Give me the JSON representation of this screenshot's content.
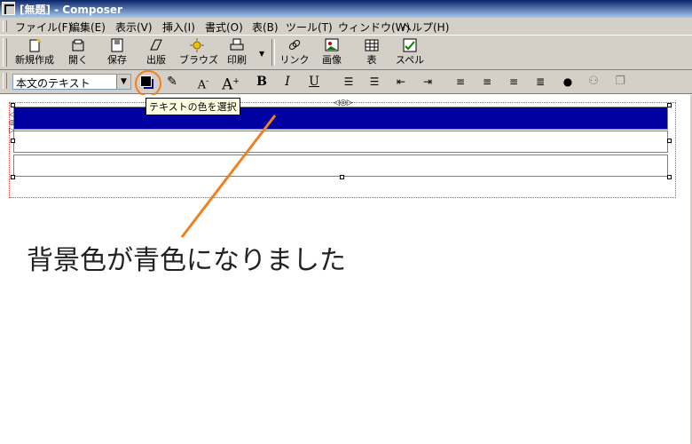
{
  "window": {
    "title": "[無題] - Composer"
  },
  "menu": [
    "ファイル(F)",
    "編集(E)",
    "表示(V)",
    "挿入(I)",
    "書式(O)",
    "表(B)",
    "ツール(T)",
    "ウィンドウ(W)",
    "ヘルプ(H)"
  ],
  "toolbar": {
    "new_label": "新規作成",
    "open_label": "開く",
    "save_label": "保存",
    "publish_label": "出版",
    "browse_label": "ブラウズ",
    "print_label": "印刷",
    "link_label": "リンク",
    "image_label": "画像",
    "table_label": "表",
    "spell_label": "スペル"
  },
  "format": {
    "paragraph_style": "本文のテキスト",
    "bold": "B",
    "italic": "I",
    "underline": "U",
    "smaller": "A",
    "larger": "A"
  },
  "tooltip": "テキストの色を選択",
  "annotation": "背景色が青色になりました",
  "colors": {
    "row_background": "#0000a0",
    "highlight_ring": "#f08020",
    "annotation_line": "#f08020"
  }
}
